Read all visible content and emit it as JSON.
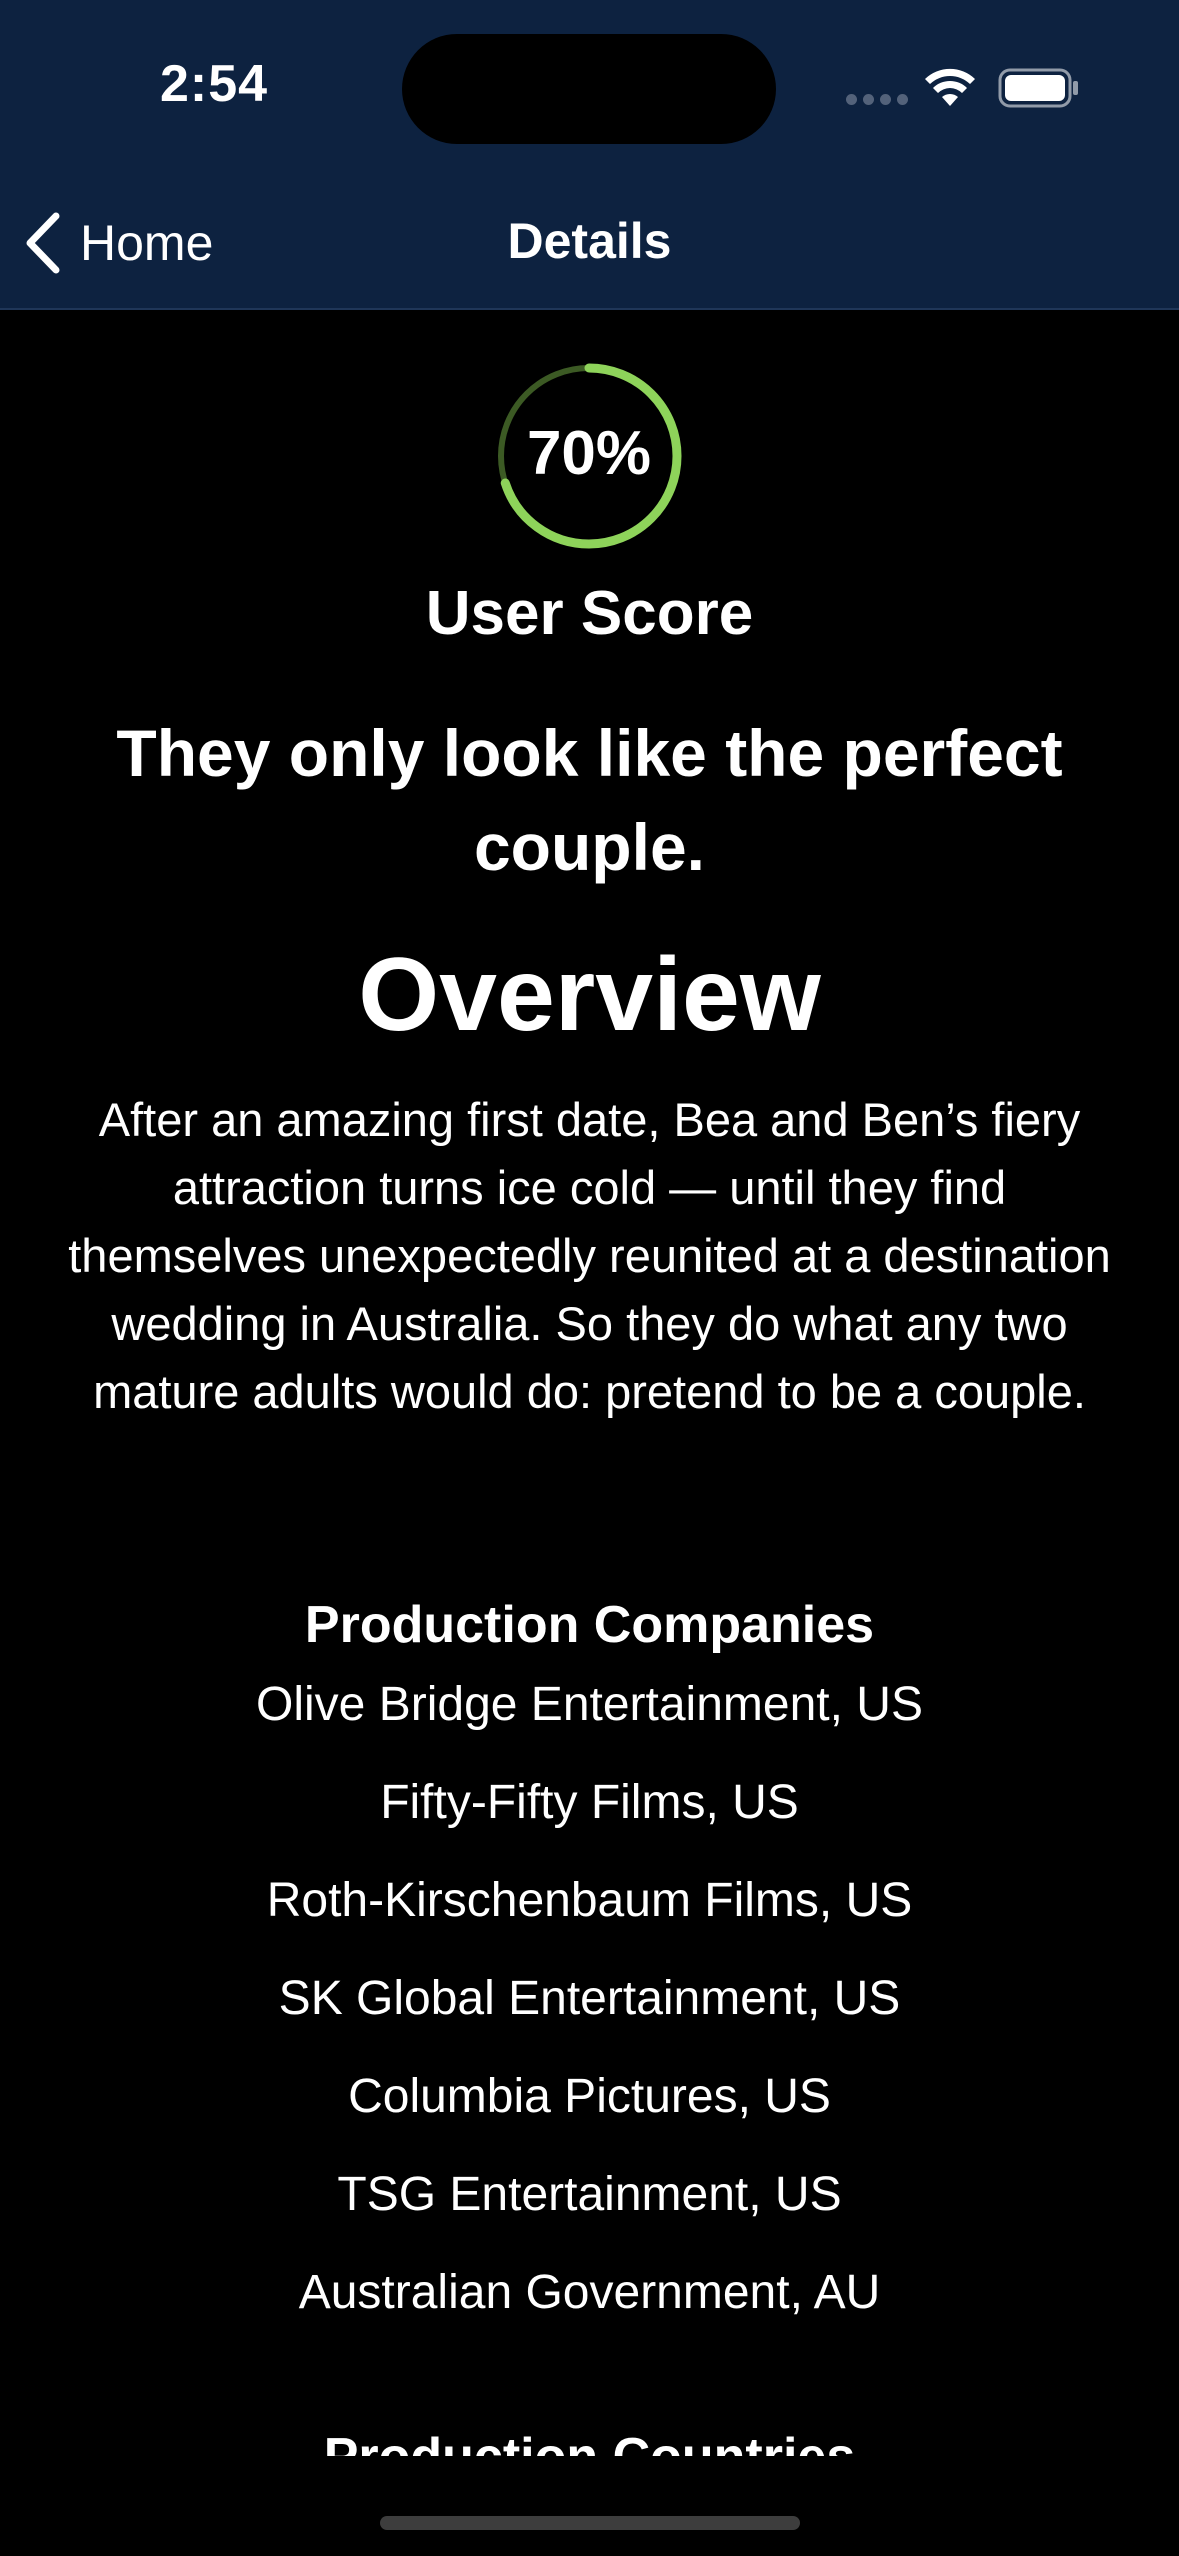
{
  "status_bar": {
    "time": "2:54"
  },
  "nav": {
    "back_label": "Home",
    "title": "Details"
  },
  "score": {
    "value": 70,
    "display": "70%",
    "label": "User Score",
    "ring_color": "#8ed35a"
  },
  "tagline": "They only look like the perfect couple.",
  "overview": {
    "heading": "Overview",
    "text": "After an amazing first date, Bea and Ben’s fiery attraction turns ice cold — until they find themselves unexpectedly reunited at a destination wedding in Australia. So they do what any two mature adults would do: pretend to be a couple."
  },
  "production_companies": {
    "heading": "Production Companies",
    "items": [
      "Olive Bridge Entertainment, US",
      "Fifty-Fifty Films, US",
      "Roth-Kirschenbaum Films, US",
      "SK Global Entertainment, US",
      "Columbia Pictures, US",
      "TSG Entertainment, US",
      "Australian Government, AU"
    ]
  },
  "production_countries": {
    "heading": "Production Countries"
  },
  "colors": {
    "nav_background": "#0d2240",
    "page_background": "#000000",
    "text": "#ffffff"
  },
  "icons": {
    "back": "chevron-left-icon",
    "wifi": "wifi-icon",
    "battery": "battery-icon",
    "signal": "cellular-signal-icon"
  }
}
